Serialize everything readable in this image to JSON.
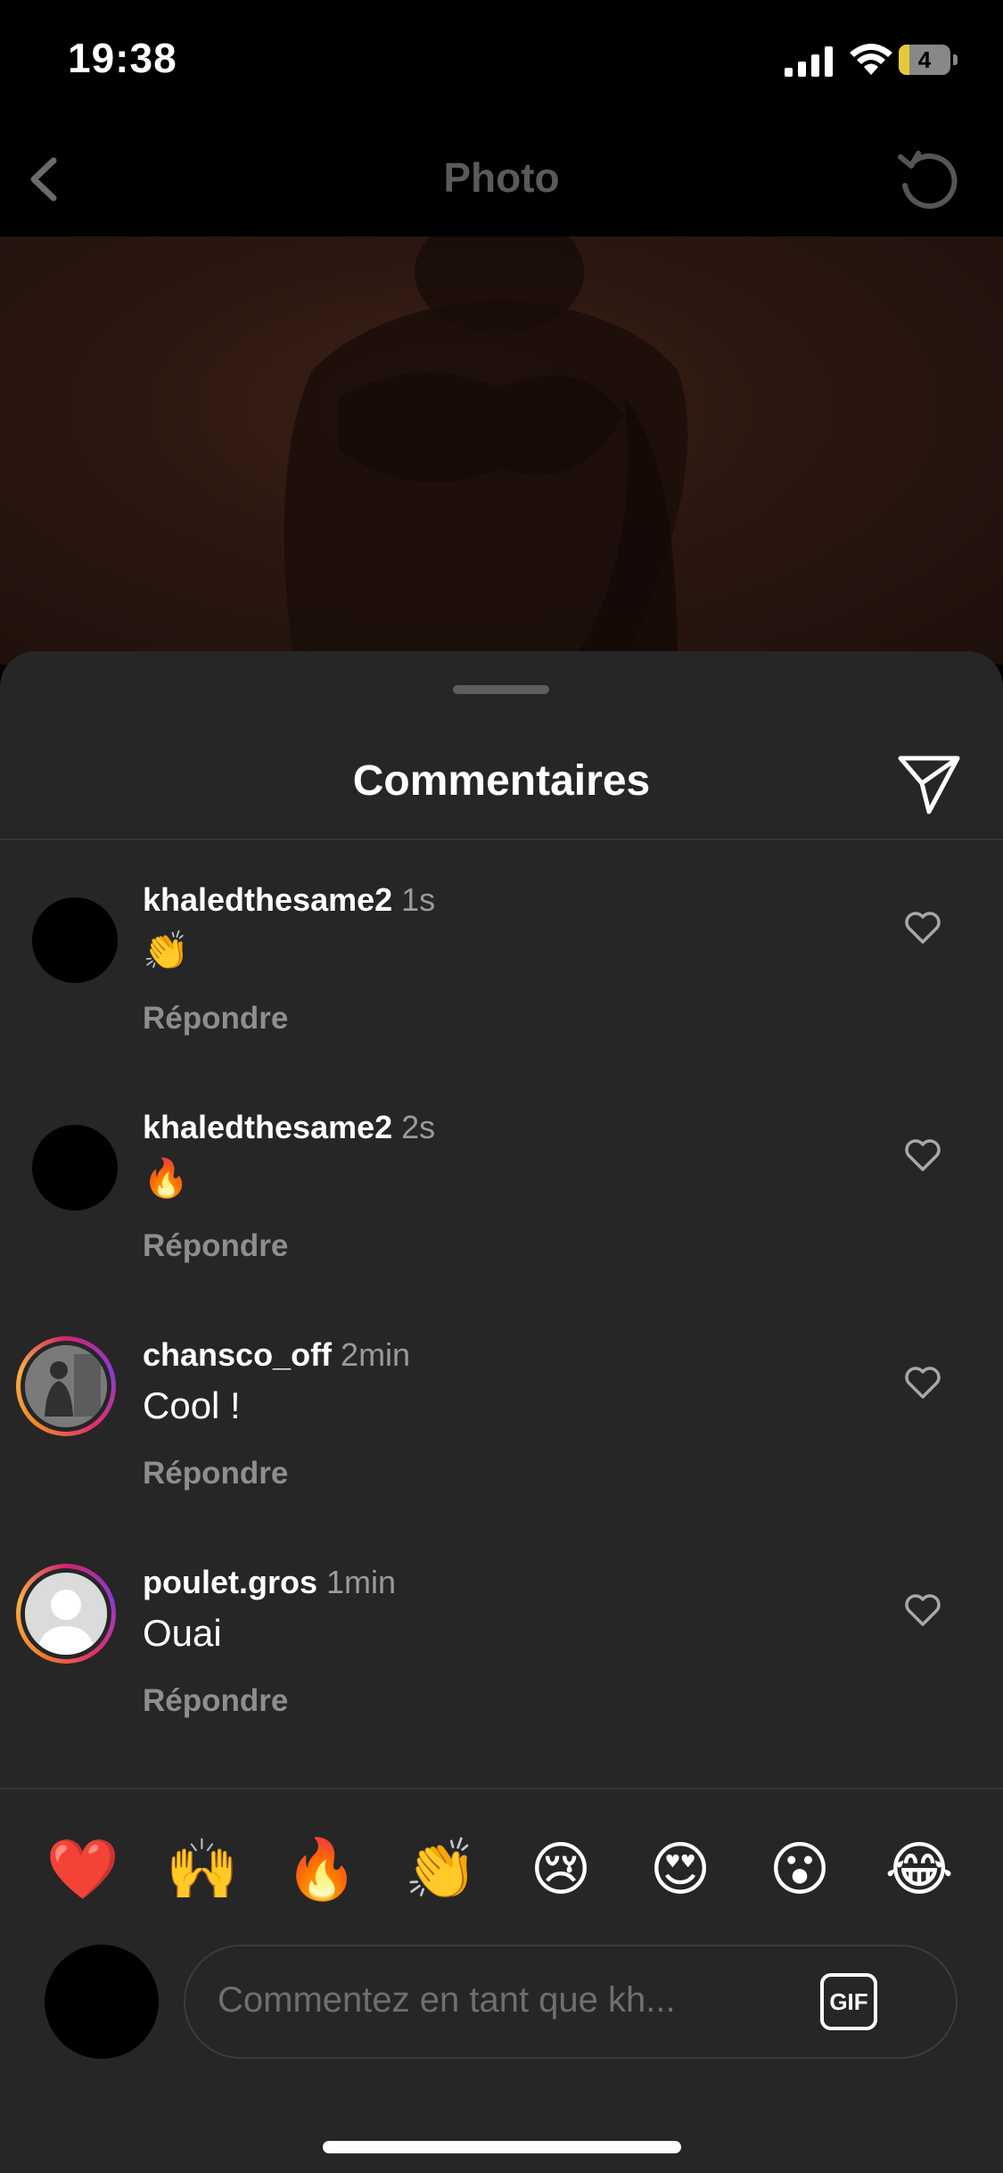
{
  "status_bar": {
    "time": "19:38",
    "battery": "4",
    "battery_level": 0.2
  },
  "nav": {
    "title": "Photo",
    "back_icon": "chevron-left-icon",
    "refresh_icon": "refresh-icon"
  },
  "sheet": {
    "title": "Commentaires",
    "share_icon": "send-icon"
  },
  "comments": [
    {
      "username": "khaledthesame2",
      "time": "1s",
      "text": "👏",
      "reply": "Répondre"
    },
    {
      "username": "khaledthesame2",
      "time": "2s",
      "text": "🔥",
      "reply": "Répondre"
    },
    {
      "username": "chansco_off",
      "time": "2min",
      "text": "Cool !",
      "reply": "Répondre"
    },
    {
      "username": "poulet.gros",
      "time": "1min",
      "text": "Ouai",
      "reply": "Répondre"
    }
  ],
  "quick_reactions": [
    "❤️",
    "🙌",
    "🔥",
    "👏",
    "😢",
    "😍",
    "😮",
    "😂"
  ],
  "composer": {
    "placeholder": "Commentez en tant que kh...",
    "gif_label": "GIF"
  },
  "colors": {
    "sheet_bg": "#262626",
    "muted_text": "#8e8e8e",
    "story_ring": "#e1306c"
  }
}
